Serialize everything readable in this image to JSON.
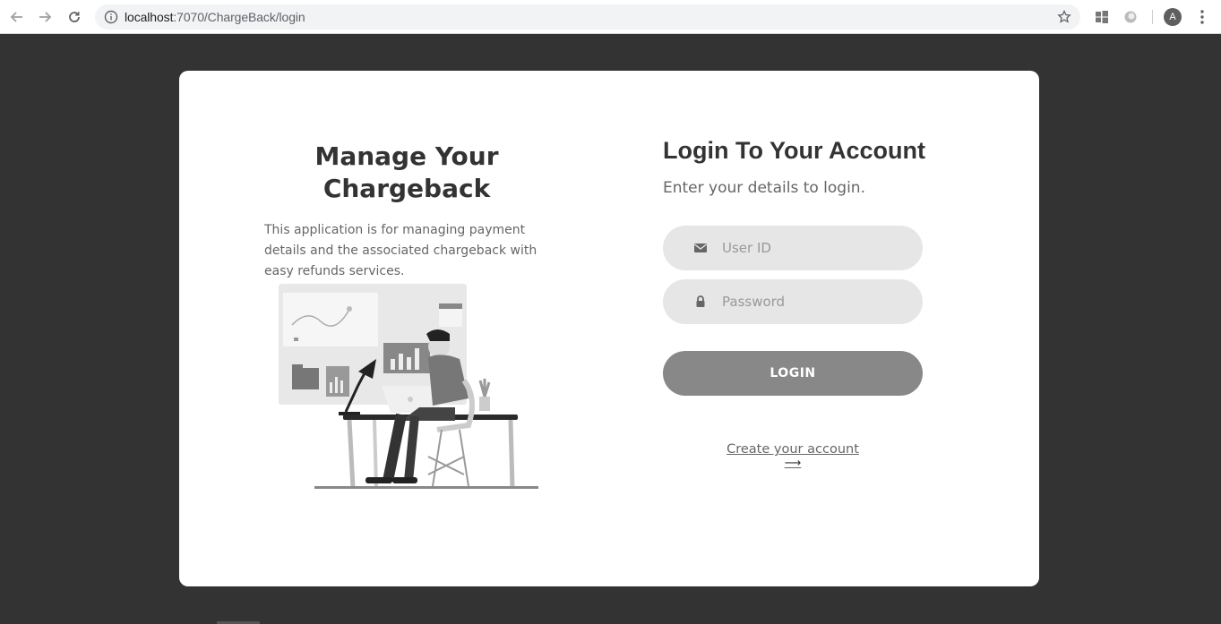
{
  "browser": {
    "url_host": "localhost",
    "url_path": ":7070/ChargeBack/login",
    "profile_initial": "A",
    "icons": [
      "back-icon",
      "forward-icon",
      "reload-icon",
      "info-icon",
      "bookmark-star-icon",
      "windows-extension-icon",
      "circle-extension-icon",
      "kebab-menu-icon"
    ]
  },
  "left": {
    "title": "Manage Your Chargeback",
    "description": "This application is for managing payment details and the associated chargeback with easy refunds services."
  },
  "login": {
    "title": "Login To Your Account",
    "subtitle": "Enter your details to login.",
    "user_placeholder": "User ID",
    "password_placeholder": "Password",
    "button_label": "LOGIN",
    "create_account_label": "Create your account",
    "create_account_arrow": "⟶"
  },
  "colors": {
    "background": "#333333",
    "card": "#ffffff",
    "field": "#e6e6e6",
    "button": "#888888"
  }
}
